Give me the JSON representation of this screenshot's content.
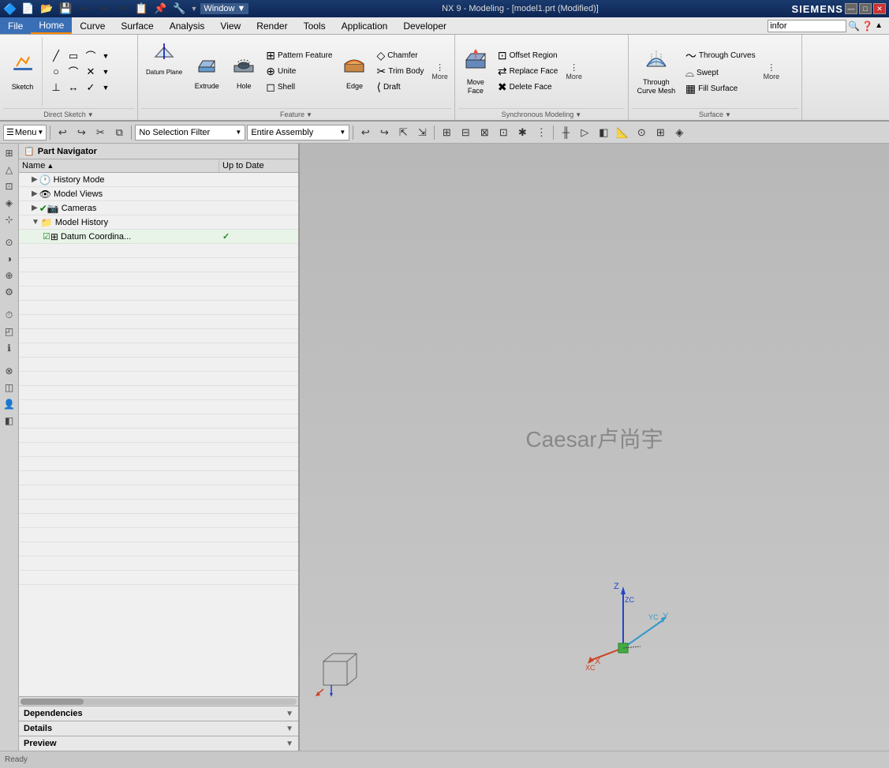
{
  "titlebar": {
    "title": "NX 9 - Modeling - [model1.prt (Modified)]",
    "siemens": "SIEMENS",
    "win_buttons": [
      "—",
      "□",
      "✕"
    ]
  },
  "menubar": {
    "items": [
      "File",
      "Home",
      "Curve",
      "Surface",
      "Analysis",
      "View",
      "Render",
      "Tools",
      "Application",
      "Developer"
    ]
  },
  "ribbon": {
    "groups": {
      "direct_sketch": {
        "label": "Direct Sketch",
        "sketch_btn": "Sketch",
        "shapes": [
          [
            "▭",
            "◯",
            "✕"
          ],
          [
            "⌒",
            "⌒",
            "⌒"
          ]
        ]
      },
      "feature": {
        "label": "Feature",
        "datum_plane": "Datum Plane",
        "extrude": "Extrude",
        "hole": "Hole",
        "pattern_feature": "Pattern Feature",
        "unite": "Unite",
        "shell": "Shell",
        "edge": "Edge",
        "edge_blend": "Edge\nBlend",
        "more_label": "More",
        "chamfer": "Chamfer",
        "trim_body": "Trim Body",
        "draft": "Draft"
      },
      "synchronous_modeling": {
        "label": "Synchronous Modeling",
        "move_face": "Move\nFace",
        "offset_region": "Offset Region",
        "replace_face": "Replace Face",
        "delete_face": "Delete Face",
        "more_label": "More"
      },
      "surface": {
        "label": "Surface",
        "through_curve_mesh": "Through\nCurve Mesh",
        "through_curves": "Through\nCurves",
        "swept": "Swept",
        "fill_surface": "Fill Surface",
        "more_label": "More"
      }
    }
  },
  "toolbar": {
    "menu_label": "Menu",
    "selection_filter": "No Selection Filter",
    "assembly_filter": "Entire Assembly"
  },
  "part_navigator": {
    "title": "Part Navigator",
    "columns": {
      "name": "Name",
      "sort_indicator": "▲",
      "up_to_date": "Up to Date"
    },
    "items": [
      {
        "level": 1,
        "label": "History Mode",
        "icon": "🕐",
        "status": ""
      },
      {
        "level": 1,
        "label": "Model Views",
        "icon": "👁",
        "status": ""
      },
      {
        "level": 1,
        "label": "Cameras",
        "icon": "📷",
        "status": ""
      },
      {
        "level": 1,
        "label": "Model History",
        "icon": "📁",
        "status": ""
      },
      {
        "level": 2,
        "label": "Datum Coordina...",
        "icon": "⊞",
        "status": "✓"
      }
    ]
  },
  "bottom_panels": [
    {
      "label": "Dependencies"
    },
    {
      "label": "Details"
    },
    {
      "label": "Preview"
    }
  ],
  "viewport": {
    "watermark": "Caesar卢尚宇"
  },
  "search": {
    "placeholder": "infor"
  },
  "coord_axes": {
    "z_label": "Z",
    "zc_label": "ZC",
    "y_label": "Y",
    "yc_label": "YC",
    "xc_label": "XC",
    "x_label": "X"
  }
}
